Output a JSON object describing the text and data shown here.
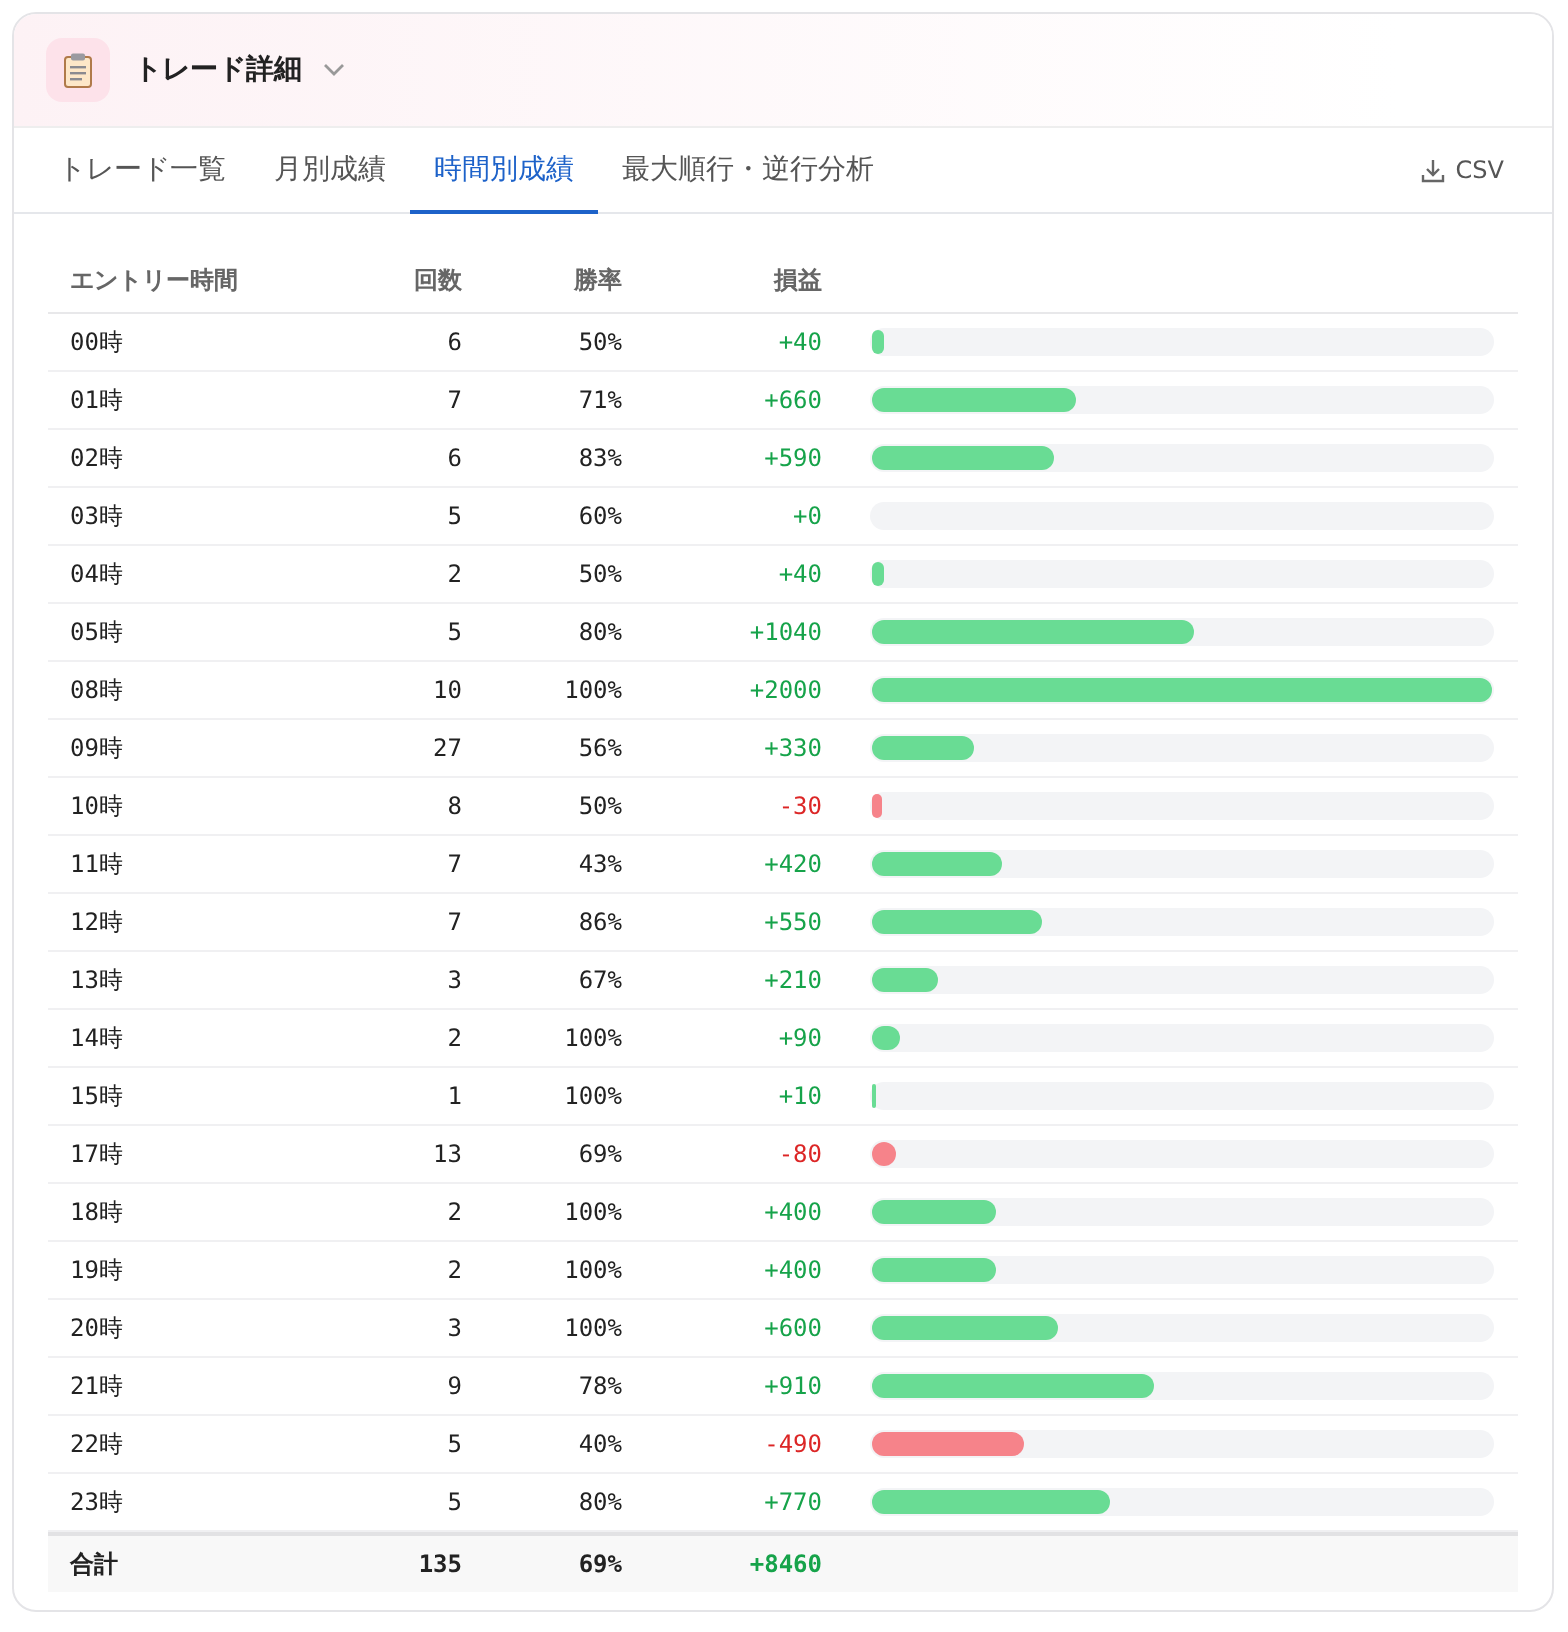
{
  "header": {
    "title": "トレード詳細"
  },
  "tabs": [
    {
      "label": "トレード一覧",
      "selected": false
    },
    {
      "label": "月別成績",
      "selected": false
    },
    {
      "label": "時間別成績",
      "selected": true
    },
    {
      "label": "最大順行・逆行分析",
      "selected": false
    }
  ],
  "export_button": "CSV",
  "table": {
    "columns": [
      "エントリー時間",
      "回数",
      "勝率",
      "損益"
    ],
    "rows": [
      {
        "hour": "00時",
        "count": "6",
        "win_rate": "50%",
        "pnl": "+40",
        "kind": "gain",
        "level": 0.02
      },
      {
        "hour": "01時",
        "count": "7",
        "win_rate": "71%",
        "pnl": "+660",
        "kind": "gain",
        "level": 0.33
      },
      {
        "hour": "02時",
        "count": "6",
        "win_rate": "83%",
        "pnl": "+590",
        "kind": "gain",
        "level": 0.295
      },
      {
        "hour": "03時",
        "count": "5",
        "win_rate": "60%",
        "pnl": "+0",
        "kind": "gain"
      },
      {
        "hour": "04時",
        "count": "2",
        "win_rate": "50%",
        "pnl": "+40",
        "kind": "gain",
        "level": 0.02
      },
      {
        "hour": "05時",
        "count": "5",
        "win_rate": "80%",
        "pnl": "+1040",
        "kind": "gain",
        "level": 0.52
      },
      {
        "hour": "08時",
        "count": "10",
        "win_rate": "100%",
        "pnl": "+2000",
        "kind": "gain",
        "level": 1
      },
      {
        "hour": "09時",
        "count": "27",
        "win_rate": "56%",
        "pnl": "+330",
        "kind": "gain",
        "level": 0.165
      },
      {
        "hour": "10時",
        "count": "8",
        "win_rate": "50%",
        "pnl": "-30",
        "kind": "loss",
        "level": 0.015
      },
      {
        "hour": "11時",
        "count": "7",
        "win_rate": "43%",
        "pnl": "+420",
        "kind": "gain",
        "level": 0.21
      },
      {
        "hour": "12時",
        "count": "7",
        "win_rate": "86%",
        "pnl": "+550",
        "kind": "gain",
        "level": 0.275
      },
      {
        "hour": "13時",
        "count": "3",
        "win_rate": "67%",
        "pnl": "+210",
        "kind": "gain",
        "level": 0.105
      },
      {
        "hour": "14時",
        "count": "2",
        "win_rate": "100%",
        "pnl": "+90",
        "kind": "gain",
        "level": 0.045
      },
      {
        "hour": "15時",
        "count": "1",
        "win_rate": "100%",
        "pnl": "+10",
        "kind": "gain",
        "level": 0.005
      },
      {
        "hour": "17時",
        "count": "13",
        "win_rate": "69%",
        "pnl": "-80",
        "kind": "loss",
        "level": 0.04
      },
      {
        "hour": "18時",
        "count": "2",
        "win_rate": "100%",
        "pnl": "+400",
        "kind": "gain",
        "level": 0.2
      },
      {
        "hour": "19時",
        "count": "2",
        "win_rate": "100%",
        "pnl": "+400",
        "kind": "gain",
        "level": 0.2
      },
      {
        "hour": "20時",
        "count": "3",
        "win_rate": "100%",
        "pnl": "+600",
        "kind": "gain",
        "level": 0.3
      },
      {
        "hour": "21時",
        "count": "9",
        "win_rate": "78%",
        "pnl": "+910",
        "kind": "gain",
        "level": 0.455
      },
      {
        "hour": "22時",
        "count": "5",
        "win_rate": "40%",
        "pnl": "-490",
        "kind": "loss",
        "level": 0.245
      },
      {
        "hour": "23時",
        "count": "5",
        "win_rate": "80%",
        "pnl": "+770",
        "kind": "gain",
        "level": 0.385
      }
    ],
    "total": {
      "label": "合計",
      "count": "135",
      "win_rate": "69%",
      "pnl": "+8460",
      "kind": "gain"
    }
  }
}
